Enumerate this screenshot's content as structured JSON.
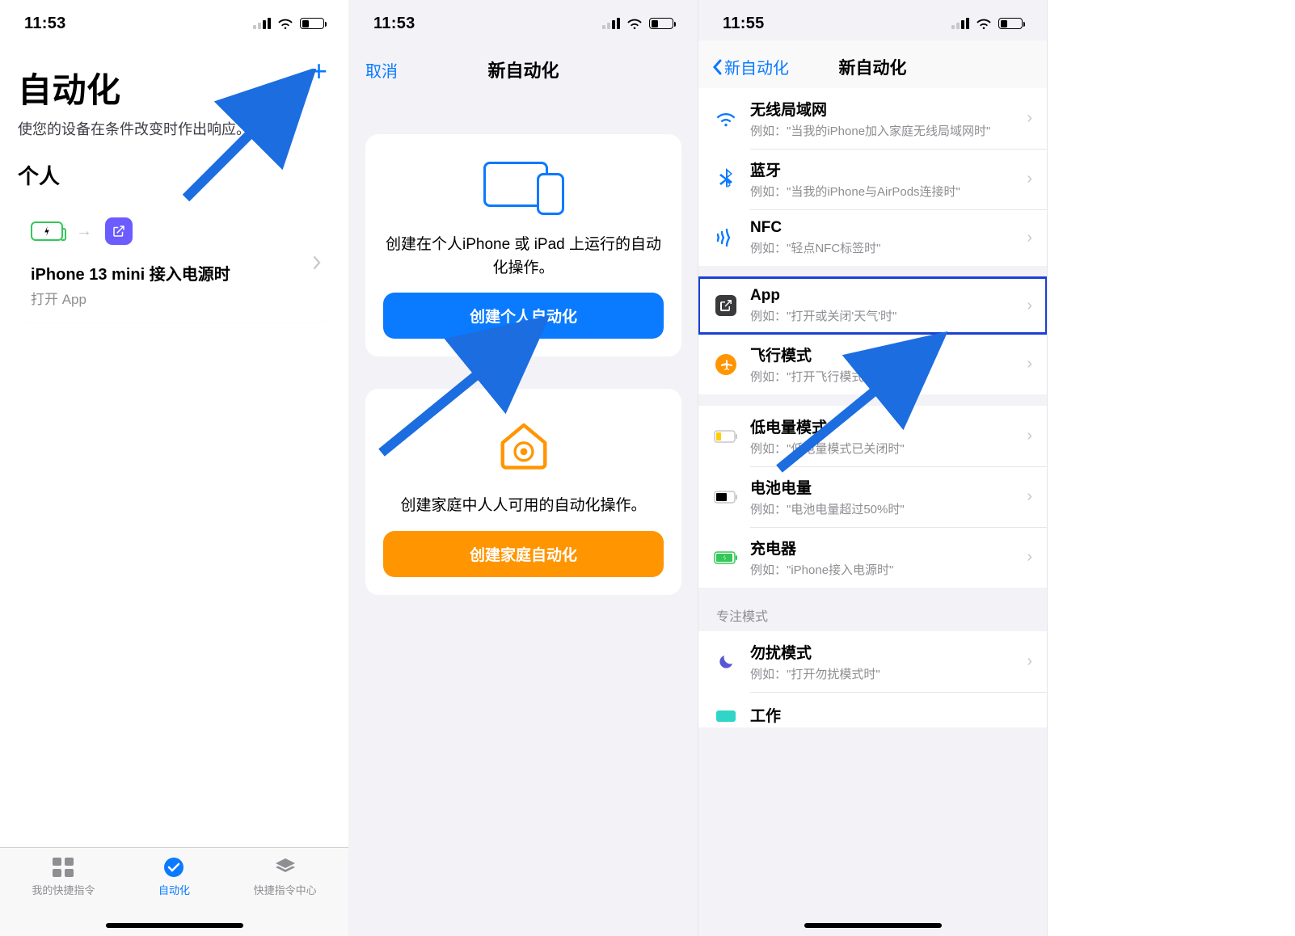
{
  "status_time_a": "11:53",
  "status_time_b": "11:53",
  "status_time_c": "11:55",
  "p1": {
    "title": "自动化",
    "subtitle": "使您的设备在条件改变时作出响应。",
    "section": "个人",
    "card_title": "iPhone 13 mini 接入电源时",
    "card_sub": "打开 App",
    "tabs": {
      "a": "我的快捷指令",
      "b": "自动化",
      "c": "快捷指令中心"
    }
  },
  "p2": {
    "cancel": "取消",
    "title": "新自动化",
    "personal_desc": "创建在个人iPhone 或 iPad 上运行的自动化操作。",
    "personal_btn": "创建个人自动化",
    "home_desc": "创建家庭中人人可用的自动化操作。",
    "home_btn": "创建家庭自动化"
  },
  "p3": {
    "back": "新自动化",
    "title": "新自动化",
    "rows": {
      "wifi": {
        "t": "无线局域网",
        "s": "例如：\"当我的iPhone加入家庭无线局域网时\""
      },
      "bt": {
        "t": "蓝牙",
        "s": "例如：\"当我的iPhone与AirPods连接时\""
      },
      "nfc": {
        "t": "NFC",
        "s": "例如：\"轻点NFC标签时\""
      },
      "app": {
        "t": "App",
        "s": "例如：\"打开或关闭'天气'时\""
      },
      "air": {
        "t": "飞行模式",
        "s": "例如：\"打开飞行模式时\""
      },
      "low": {
        "t": "低电量模式",
        "s": "例如：\"低电量模式已关闭时\""
      },
      "bat": {
        "t": "电池电量",
        "s": "例如：\"电池电量超过50%时\""
      },
      "chg": {
        "t": "充电器",
        "s": "例如：\"iPhone接入电源时\""
      },
      "focus_hdr": "专注模式",
      "dnd": {
        "t": "勿扰模式",
        "s": "例如：\"打开勿扰模式时\""
      },
      "work": {
        "t": "工作"
      }
    }
  }
}
